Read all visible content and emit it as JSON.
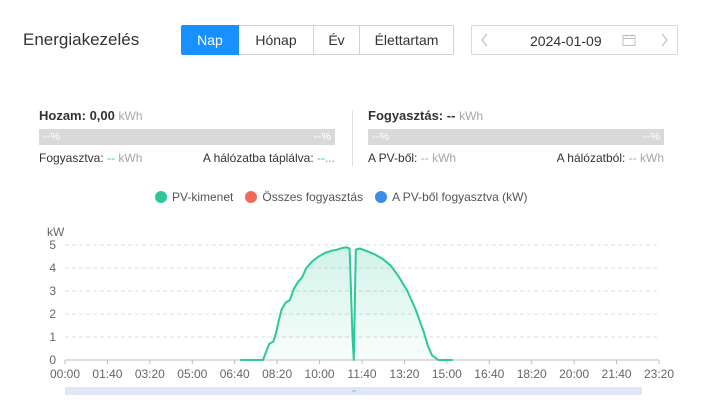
{
  "header": {
    "title": "Energiakezelés",
    "tabs": [
      {
        "label": "Nap",
        "active": true
      },
      {
        "label": "Hónap",
        "active": false
      },
      {
        "label": "Év",
        "active": false
      },
      {
        "label": "Élettartam",
        "active": false
      }
    ],
    "date": "2024-01-09",
    "prev_icon": "chevron-left-icon",
    "next_icon": "chevron-right-icon",
    "calendar_icon": "calendar-icon"
  },
  "yield_panel": {
    "label": "Hozam:",
    "value": "0,00",
    "unit": "kWh",
    "bar_left": "--%",
    "bar_right": "--%",
    "self_consumed_label": "Fogyasztva:",
    "self_consumed_value": "--",
    "self_consumed_unit": "kWh",
    "grid_fed_label": "A hálózatba táplálva:",
    "grid_fed_value": "--..."
  },
  "consumption_panel": {
    "label": "Fogyasztás:",
    "value": "--",
    "unit": "kWh",
    "bar_left": "--%",
    "bar_right": "--%",
    "from_pv_label": "A PV-ből:",
    "from_pv_value": "--",
    "from_pv_unit": "kWh",
    "from_grid_label": "A hálózatból:",
    "from_grid_value": "--",
    "from_grid_unit": "kWh"
  },
  "colors": {
    "accent": "#1890ff",
    "pv": "#2dc89a",
    "total": "#f06a5a",
    "self": "#3a8ee6",
    "bar_gray": "#d9d9d9"
  },
  "chart_data": {
    "type": "area",
    "ylabel": "kW",
    "ylim": [
      0,
      5
    ],
    "yticks": [
      0,
      1,
      2,
      3,
      4,
      5
    ],
    "xticks": [
      "00:00",
      "01:40",
      "03:20",
      "05:00",
      "06:40",
      "08:20",
      "10:00",
      "11:40",
      "13:20",
      "15:00",
      "16:40",
      "18:20",
      "20:00",
      "21:40",
      "23:20"
    ],
    "xlim_minutes": [
      0,
      1440
    ],
    "grid": true,
    "legend": "top",
    "series": [
      {
        "name": "PV-kimenet",
        "color": "#2dc89a",
        "points": [
          [
            425,
            0
          ],
          [
            480,
            0
          ],
          [
            495,
            0.7
          ],
          [
            505,
            0.8
          ],
          [
            512,
            1.2
          ],
          [
            518,
            1.7
          ],
          [
            525,
            2.2
          ],
          [
            535,
            2.5
          ],
          [
            545,
            2.6
          ],
          [
            555,
            3.1
          ],
          [
            565,
            3.4
          ],
          [
            575,
            3.6
          ],
          [
            585,
            4.0
          ],
          [
            600,
            4.3
          ],
          [
            615,
            4.5
          ],
          [
            630,
            4.65
          ],
          [
            645,
            4.75
          ],
          [
            660,
            4.8
          ],
          [
            672,
            4.87
          ],
          [
            682,
            4.9
          ],
          [
            690,
            4.85
          ],
          [
            697,
            1.0
          ],
          [
            700,
            0
          ],
          [
            705,
            4.8
          ],
          [
            715,
            4.85
          ],
          [
            730,
            4.75
          ],
          [
            750,
            4.6
          ],
          [
            770,
            4.4
          ],
          [
            790,
            4.1
          ],
          [
            810,
            3.6
          ],
          [
            830,
            3.0
          ],
          [
            850,
            2.2
          ],
          [
            870,
            1.2
          ],
          [
            880,
            0.6
          ],
          [
            890,
            0.2
          ],
          [
            905,
            0
          ],
          [
            940,
            0
          ]
        ]
      },
      {
        "name": "Összes fogyasztás",
        "color": "#f06a5a",
        "points": []
      },
      {
        "name": "A PV-ből fogyasztva (kW)",
        "color": "#3a8ee6",
        "points": []
      }
    ]
  }
}
